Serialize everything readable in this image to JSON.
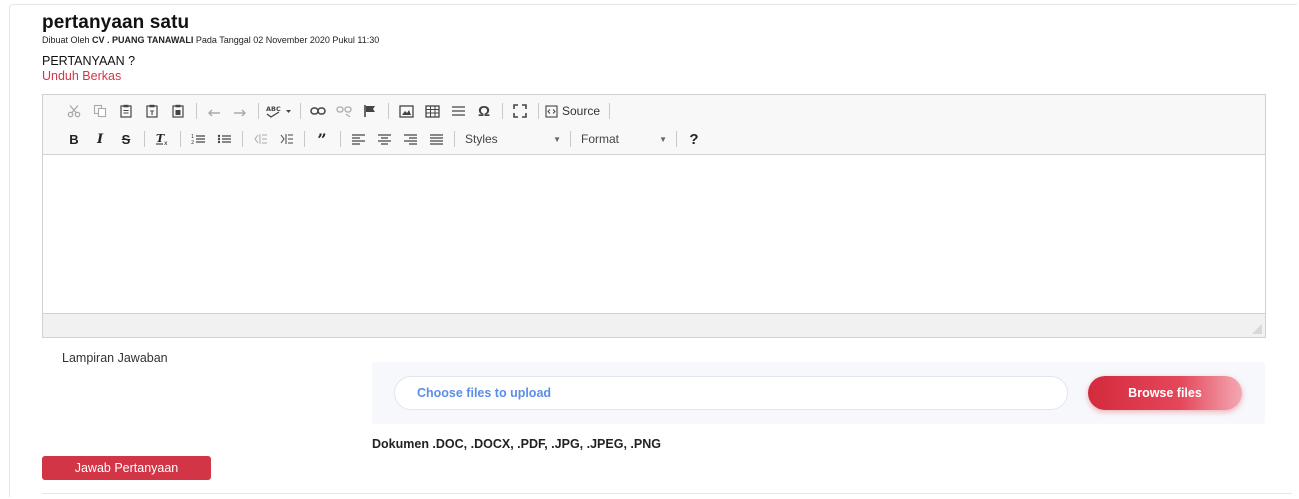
{
  "question": {
    "title": "pertanyaan satu",
    "meta_prefix": "Dibuat Oleh",
    "author": "CV . PUANG TANAWALI",
    "meta_suffix": "Pada Tanggal 02 November 2020 Pukul 11:30",
    "body": "PERTANYAAN ?",
    "download_link": "Unduh Berkas"
  },
  "editor": {
    "source_label": "Source",
    "styles_label": "Styles",
    "format_label": "Format",
    "help_label": "?"
  },
  "attachment": {
    "label": "Lampiran Jawaban",
    "placeholder": "Choose files to upload",
    "browse_label": "Browse files",
    "allowed_types": "Dokumen .DOC, .DOCX, .PDF, .JPG, .JPEG, .PNG"
  },
  "actions": {
    "submit_label": "Jawab Pertanyaan"
  },
  "colors": {
    "accent": "#d13546",
    "link_blue": "#5b8ee6"
  }
}
